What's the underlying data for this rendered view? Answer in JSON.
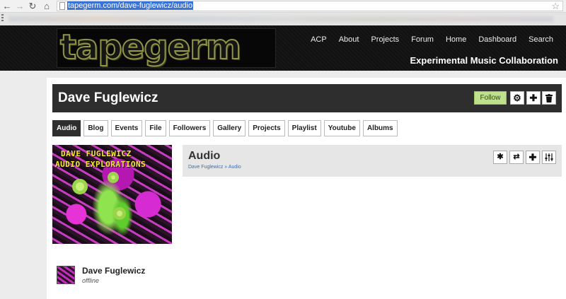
{
  "browser": {
    "url": "tapegerm.com/dave-fuglewicz/audio",
    "back_icon": "arrow-left-icon",
    "forward_icon": "arrow-right-icon",
    "reload_icon": "reload-icon",
    "home_icon": "home-icon",
    "bookmark_icon": "star-icon"
  },
  "site": {
    "logo_text": "tapegerm",
    "tagline": "Experimental Music Collaboration",
    "nav": [
      "ACP",
      "About",
      "Projects",
      "Forum",
      "Home",
      "Dashboard",
      "Search"
    ]
  },
  "profile": {
    "name": "Dave Fuglewicz",
    "follow_label": "Follow",
    "action_icons": [
      "gear-icon",
      "plus-icon",
      "trash-icon"
    ],
    "tabs": [
      "Audio",
      "Blog",
      "Events",
      "File",
      "Followers",
      "Gallery",
      "Projects",
      "Playlist",
      "Youtube",
      "Albums"
    ],
    "active_tab": "Audio",
    "image_caption_line1": "DAVE FUGLEWICZ",
    "image_caption_line2": "AUDIO EXPLORATIONS"
  },
  "audio": {
    "title": "Audio",
    "breadcrumb": [
      "Dave Fuglewicz",
      "Audio"
    ],
    "breadcrumb_separator": "»",
    "tool_icons": [
      "asterisk-icon",
      "shuffle-icon",
      "plus-icon",
      "sliders-icon"
    ]
  },
  "user_card": {
    "name": "Dave Fuglewicz",
    "status": "offline"
  },
  "colors": {
    "header_bg": "#121212",
    "title_bar_bg": "#2e2e2e",
    "follow_bg": "#bfe08c",
    "logo_stroke": "#8f9448",
    "caption_yellow": "#f2ec2a",
    "link_blue": "#3b6fae"
  }
}
